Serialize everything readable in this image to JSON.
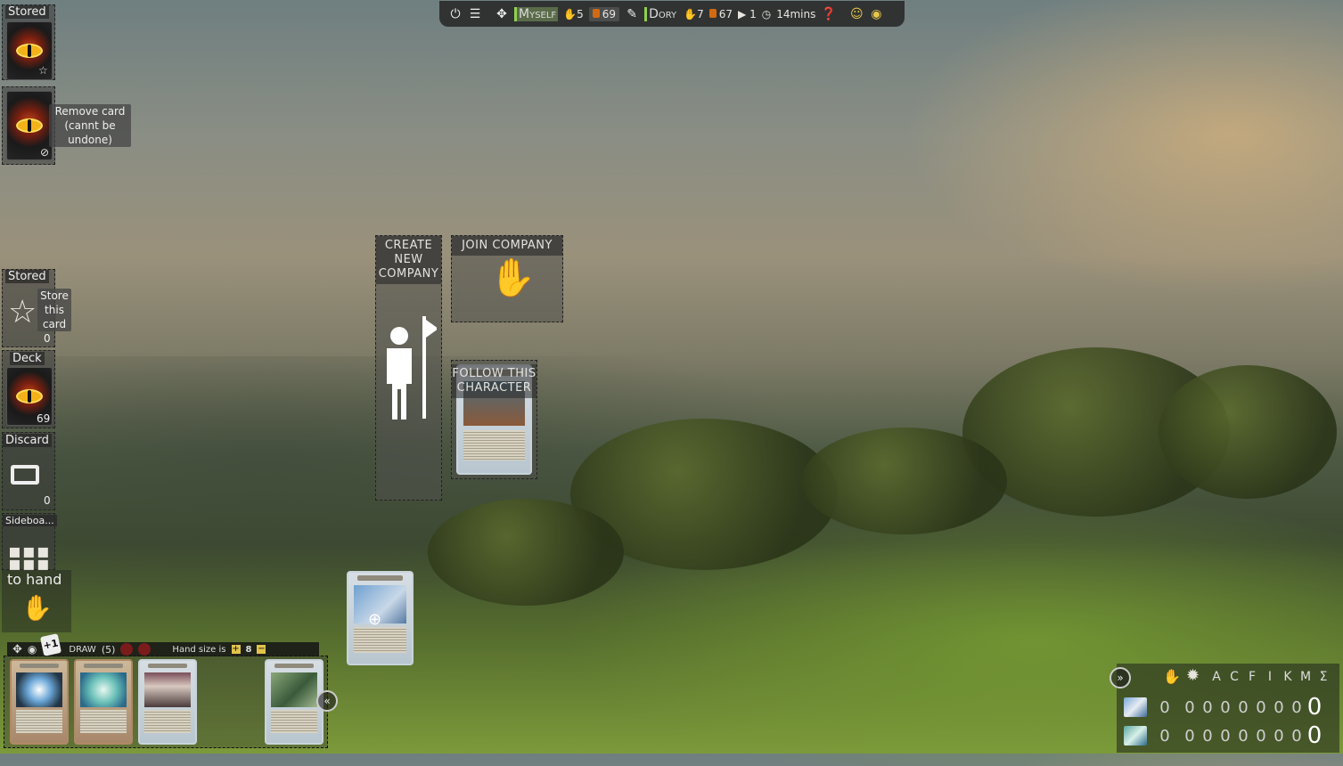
{
  "topbar": {
    "power_icon": "power-icon",
    "settings_icon": "sliders-icon",
    "player1": {
      "name": "Myself",
      "hand": "5",
      "deck": "69"
    },
    "player2": {
      "name": "Dory",
      "hand": "7",
      "deck": "67"
    },
    "turn": "1",
    "time": "14mins",
    "accent": "#8fd14f"
  },
  "left": {
    "stored_top_label": "Stored",
    "remove_tip": "Remove card (cannt be undone)",
    "stored_label": "Stored",
    "store_tip": "Store this card",
    "stored_count": "0",
    "deck_label": "Deck",
    "deck_count": "69",
    "discard_label": "Discard",
    "discard_count": "0",
    "sideboard_label": "Sideboa...",
    "to_hand_label": "to hand"
  },
  "center": {
    "create_company": "CREATE NEW COMPANY",
    "join_company": "JOIN COMPANY",
    "follow_character": "FOLLOW THIS CHARACTER"
  },
  "hand": {
    "draw_label": "DRAW",
    "draw_count": "(5)",
    "hand_size_label": "Hand size is",
    "hand_size": "8"
  },
  "score": {
    "headers": [
      "A",
      "C",
      "F",
      "I",
      "K",
      "M",
      "Σ"
    ],
    "rows": [
      {
        "values": [
          "0",
          "0",
          "0",
          "0",
          "0",
          "0",
          "0",
          "0"
        ],
        "total": "0"
      },
      {
        "values": [
          "0",
          "0",
          "0",
          "0",
          "0",
          "0",
          "0",
          "0"
        ],
        "total": "0"
      }
    ]
  }
}
